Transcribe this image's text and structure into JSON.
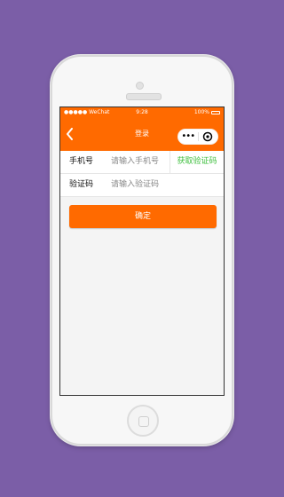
{
  "statusbar": {
    "carrier": "●●●●● WeChat",
    "time": "9:28",
    "battery": "100%"
  },
  "navbar": {
    "title": "登录",
    "capsule_menu": "•••",
    "icons": {
      "back": "chevron-left-icon",
      "menu": "more-icon",
      "close": "target-icon"
    }
  },
  "form": {
    "phone_label": "手机号",
    "phone_placeholder": "请输入手机号",
    "get_code_label": "获取验证码",
    "code_label": "验证码",
    "code_placeholder": "请输入验证码"
  },
  "actions": {
    "confirm_label": "确定"
  },
  "colors": {
    "accent": "#ff6a00",
    "code_link": "#3fbf3f",
    "background": "#7b5ea7"
  }
}
